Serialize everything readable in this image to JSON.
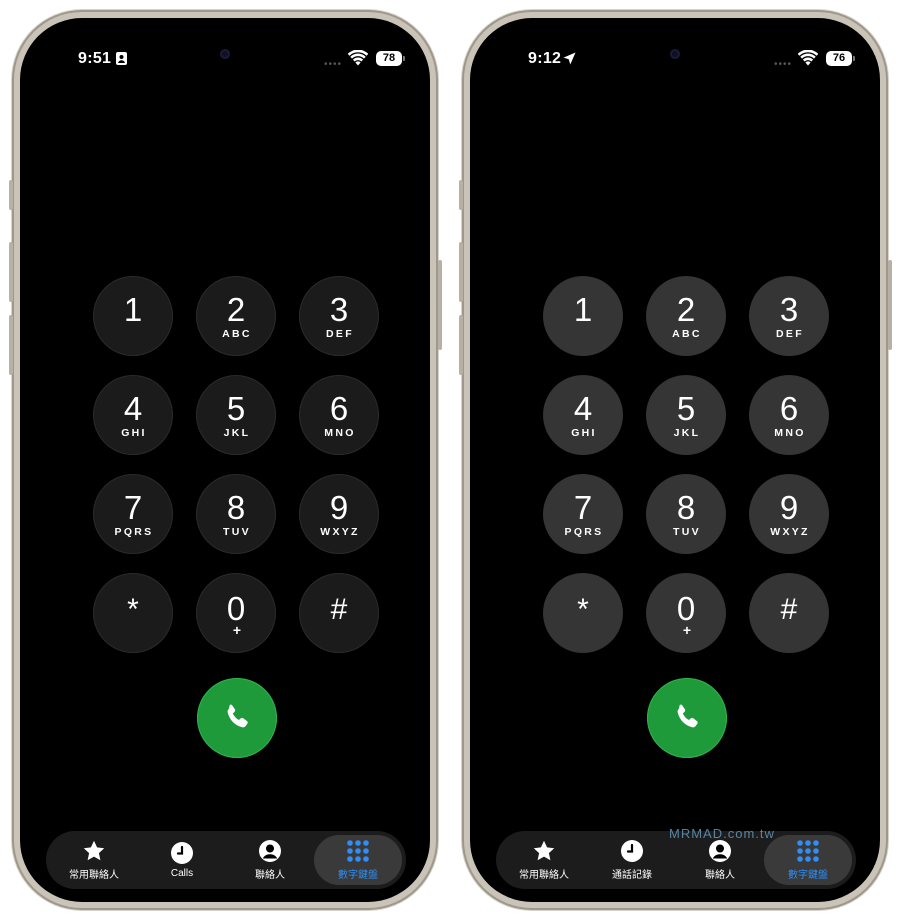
{
  "phones": [
    {
      "status": {
        "time": "9:51",
        "time_icon": "focus-person-icon",
        "battery": "78"
      },
      "keys": [
        {
          "digit": "1",
          "letters": ""
        },
        {
          "digit": "2",
          "letters": "ABC"
        },
        {
          "digit": "3",
          "letters": "DEF"
        },
        {
          "digit": "4",
          "letters": "GHI"
        },
        {
          "digit": "5",
          "letters": "JKL"
        },
        {
          "digit": "6",
          "letters": "MNO"
        },
        {
          "digit": "7",
          "letters": "PQRS"
        },
        {
          "digit": "8",
          "letters": "TUV"
        },
        {
          "digit": "9",
          "letters": "WXYZ"
        },
        {
          "digit": "*",
          "letters": ""
        },
        {
          "digit": "0",
          "letters": "+"
        },
        {
          "digit": "#",
          "letters": ""
        }
      ],
      "tabs": [
        {
          "label": "常用聯絡人",
          "icon": "star-icon"
        },
        {
          "label": "Calls",
          "icon": "clock-icon"
        },
        {
          "label": "聯絡人",
          "icon": "person-icon"
        },
        {
          "label": "數字鍵盤",
          "icon": "keypad-icon",
          "active": true
        }
      ]
    },
    {
      "status": {
        "time": "9:12",
        "time_icon": "location-arrow-icon",
        "battery": "76"
      },
      "keys": [
        {
          "digit": "1",
          "letters": ""
        },
        {
          "digit": "2",
          "letters": "ABC"
        },
        {
          "digit": "3",
          "letters": "DEF"
        },
        {
          "digit": "4",
          "letters": "GHI"
        },
        {
          "digit": "5",
          "letters": "JKL"
        },
        {
          "digit": "6",
          "letters": "MNO"
        },
        {
          "digit": "7",
          "letters": "PQRS"
        },
        {
          "digit": "8",
          "letters": "TUV"
        },
        {
          "digit": "9",
          "letters": "WXYZ"
        },
        {
          "digit": "*",
          "letters": ""
        },
        {
          "digit": "0",
          "letters": "+"
        },
        {
          "digit": "#",
          "letters": ""
        }
      ],
      "tabs": [
        {
          "label": "常用聯絡人",
          "icon": "star-icon"
        },
        {
          "label": "通話記錄",
          "icon": "clock-icon"
        },
        {
          "label": "聯絡人",
          "icon": "person-icon"
        },
        {
          "label": "數字鍵盤",
          "icon": "keypad-icon",
          "active": true
        }
      ]
    }
  ],
  "watermark": "MRMAD.com.tw",
  "colors": {
    "call_green": "#1f9a3b",
    "active_tab": "#2f8df5",
    "key_dark": "#1b1b1b",
    "key_gray": "#353535"
  }
}
